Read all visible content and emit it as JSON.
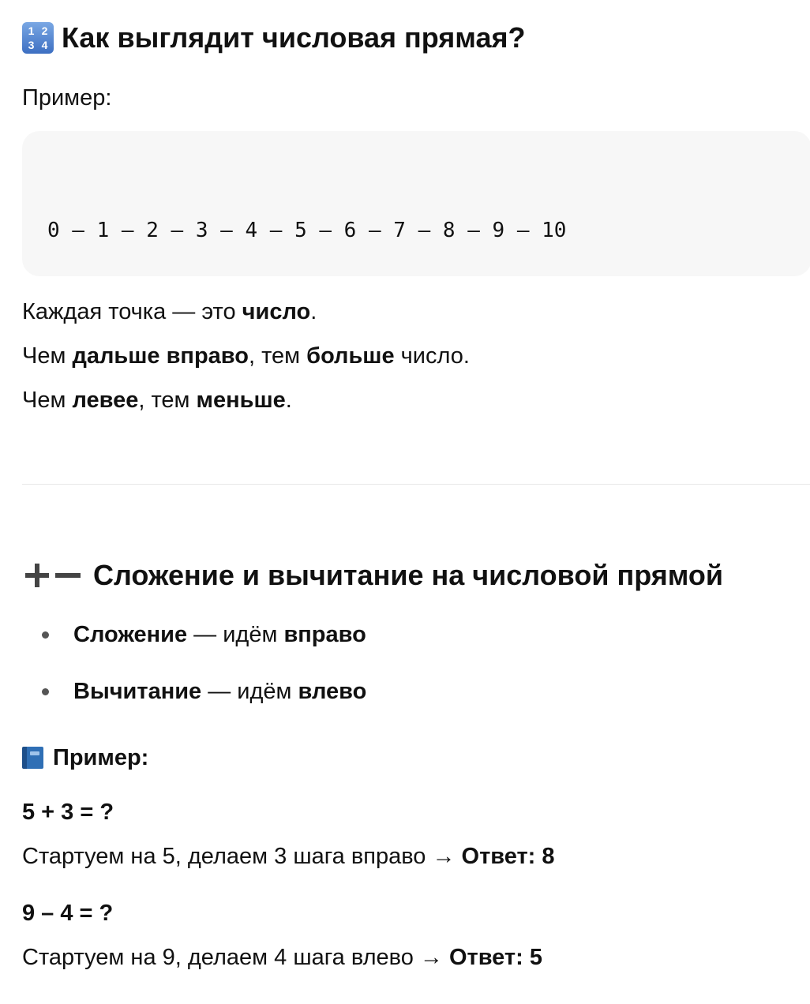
{
  "section1": {
    "heading": "Как выглядит числовая прямая?",
    "heading_icon_digits": [
      "1",
      "2",
      "3",
      "4"
    ],
    "example_label": "Пример:",
    "number_line": "0 — 1 — 2 — 3 — 4 — 5 — 6 — 7 — 8 — 9 — 10",
    "line1": {
      "t1": "Каждая точка — это ",
      "b1": "число",
      "t2": "."
    },
    "line2": {
      "t1": "Чем ",
      "b1": "дальше вправо",
      "t2": ", тем ",
      "b2": "больше",
      "t3": " число."
    },
    "line3": {
      "t1": "Чем ",
      "b1": "левее",
      "t2": ", тем ",
      "b2": "меньше",
      "t3": "."
    }
  },
  "section2": {
    "heading": "Сложение и вычитание на числовой прямой",
    "bullets": [
      {
        "b1": "Сложение",
        "t1": " — идём ",
        "b2": "вправо"
      },
      {
        "b1": "Вычитание",
        "t1": " — идём ",
        "b2": "влево"
      }
    ],
    "example_heading": "Пример:",
    "examples": [
      {
        "equation": "5 + 3 = ?",
        "text": "Стартуем на 5, делаем 3 шага вправо → ",
        "answer": "Ответ: 8"
      },
      {
        "equation": "9 – 4 = ?",
        "text": "Стартуем на 9, делаем 4 шага влево → ",
        "answer": "Ответ: 5"
      }
    ]
  },
  "icons": {
    "heading1": "input-numbers-icon",
    "heading2": "plus-minus-icon",
    "example": "blue-book-icon",
    "bullet": "bullet-dot-icon"
  },
  "colors": {
    "text": "#111111",
    "code_bg": "#f7f7f7",
    "divider": "#e8e8e8",
    "numbers_icon": "#4a7fd0",
    "book_icon": "#2f6fb5"
  }
}
